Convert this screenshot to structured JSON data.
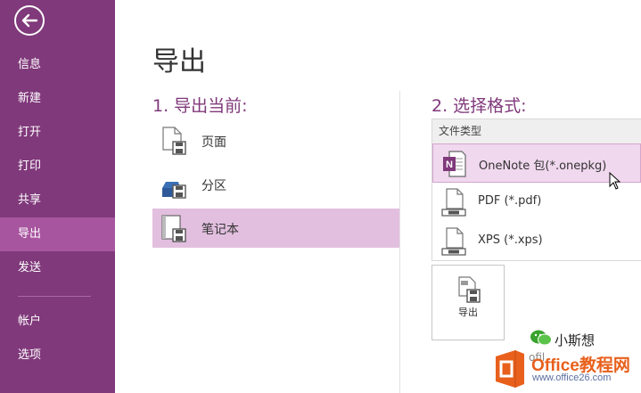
{
  "sidebar": {
    "items": [
      {
        "label": "信息"
      },
      {
        "label": "新建"
      },
      {
        "label": "打开"
      },
      {
        "label": "打印"
      },
      {
        "label": "共享"
      },
      {
        "label": "导出"
      },
      {
        "label": "发送"
      },
      {
        "label": "帐户"
      },
      {
        "label": "选项"
      }
    ],
    "active_item": "导出",
    "bg_color": "#80397b",
    "active_color": "#a855a0"
  },
  "main": {
    "title": "导出",
    "step1": {
      "heading": "1. 导出当前:",
      "options": [
        {
          "label": "页面",
          "icon": "page-export-icon"
        },
        {
          "label": "分区",
          "icon": "section-export-icon"
        },
        {
          "label": "笔记本",
          "icon": "notebook-export-icon"
        }
      ],
      "selected": "笔记本"
    },
    "step2": {
      "heading": "2. 选择格式:",
      "list_header": "文件类型",
      "formats": [
        {
          "label": "OneNote 包(*.onepkg)",
          "icon": "onenote-package-icon"
        },
        {
          "label": "PDF (*.pdf)",
          "icon": "pdf-file-icon"
        },
        {
          "label": "XPS (*.xps)",
          "icon": "xps-file-icon"
        }
      ],
      "selected": "OneNote 包(*.onepkg)"
    },
    "export_button": {
      "label": "导出"
    }
  },
  "watermark": {
    "wechat_text": "小斯想",
    "faint_text": "ofil",
    "site_name": "Office教程网",
    "url": "www.office26.com"
  },
  "colors": {
    "accent": "#80397b",
    "selection": "#e2bfdf"
  }
}
